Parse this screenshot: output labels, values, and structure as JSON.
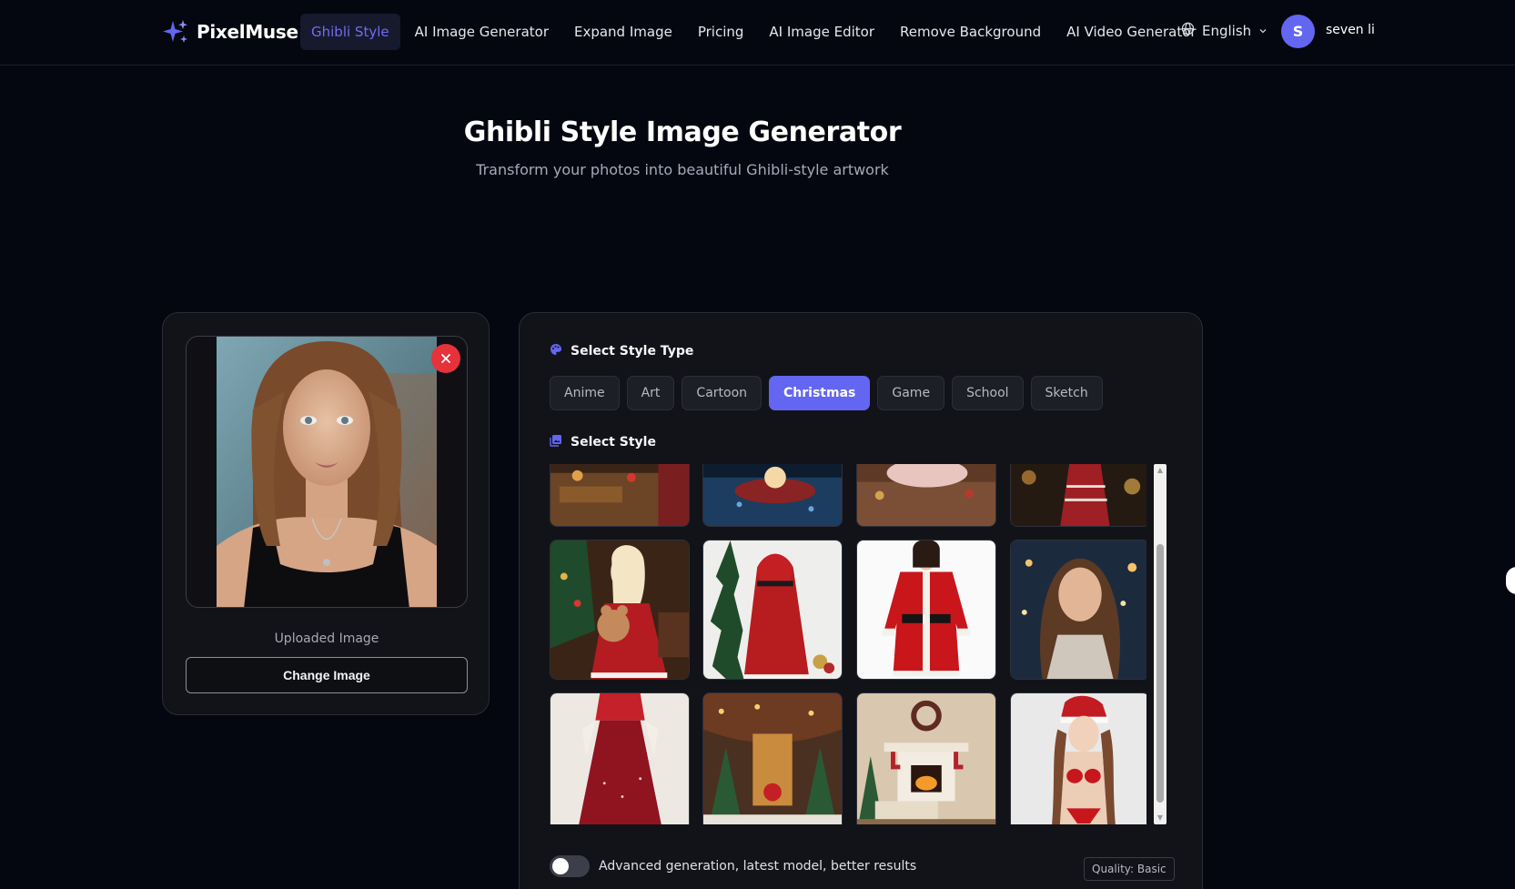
{
  "brand": {
    "name": "PixelMuse",
    "accent": "#6366f1"
  },
  "nav": {
    "links": [
      {
        "label": "Ghibli Style",
        "active": true
      },
      {
        "label": "AI Image Generator"
      },
      {
        "label": "Expand Image"
      },
      {
        "label": "Pricing"
      },
      {
        "label": "AI Image Editor"
      },
      {
        "label": "Remove Background"
      },
      {
        "label": "AI Video Generator"
      }
    ],
    "language": "English",
    "user": {
      "initial": "S",
      "name": "seven li"
    }
  },
  "hero": {
    "title": "Ghibli Style Image Generator",
    "subtitle": "Transform your photos into beautiful Ghibli-style artwork"
  },
  "upload": {
    "label": "Uploaded Image",
    "change_button": "Change Image"
  },
  "styles": {
    "type_heading": "Select Style Type",
    "style_heading": "Select Style",
    "types": [
      "Anime",
      "Art",
      "Cartoon",
      "Christmas",
      "Game",
      "School",
      "Sketch"
    ],
    "active_type": "Christmas",
    "thumbnails": [
      "christmas-living-room",
      "candle-in-hands",
      "christmas-cake-table",
      "plaid-scarf-bokeh",
      "santa-dress-teddy-bear",
      "red-santa-coat-tree",
      "red-santa-coat-white",
      "smiling-girl-snow-bokeh",
      "red-velvet-dress",
      "decorated-christmas-porch",
      "fireplace-stockings-room",
      "santa-hat-red-swimsuit"
    ]
  },
  "options": {
    "advanced_label": "Advanced generation, latest model, better results",
    "advanced_enabled": false,
    "quality": "Quality: Basic"
  }
}
